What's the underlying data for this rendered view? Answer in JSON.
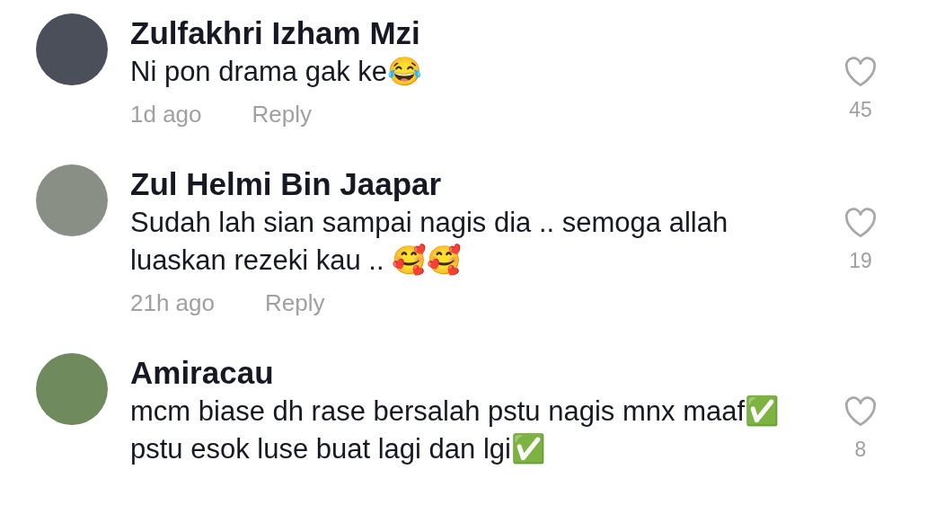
{
  "comments": [
    {
      "author": "Zulfakhri Izham Mzi",
      "text": "Ni pon drama gak ke😂",
      "time": "1d ago",
      "reply": "Reply",
      "likes": "45"
    },
    {
      "author": "Zul Helmi Bin Jaapar",
      "text": "Sudah lah sian sampai nagis dia .. semoga allah luaskan rezeki kau .. 🥰🥰",
      "time": "21h ago",
      "reply": "Reply",
      "likes": "19"
    },
    {
      "author": "Amiracau",
      "text": "mcm biase dh rase bersalah pstu nagis mnx maaf✅ pstu esok luse buat lagi dan lgi✅",
      "likes": "8"
    }
  ]
}
